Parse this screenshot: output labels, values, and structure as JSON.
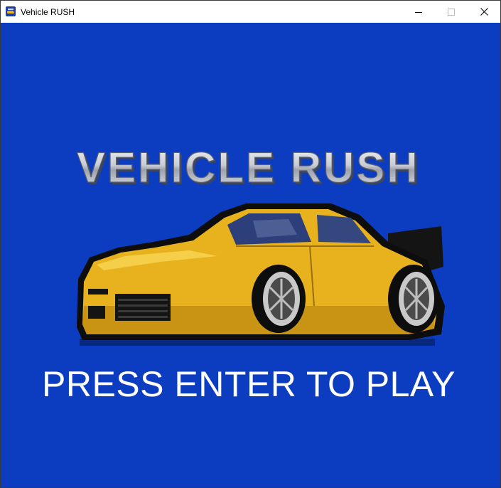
{
  "window": {
    "title": "Vehicle RUSH",
    "icon": "vehicle-rush-app-icon",
    "controls": [
      "minimize-icon",
      "maximize-icon",
      "close-icon"
    ]
  },
  "game": {
    "logo_text": "VEHICLE RUSH",
    "prompt": "PRESS ENTER TO PLAY",
    "colors": {
      "background": "#0c3dc0",
      "car_body": "#e8b21e",
      "car_shadow": "#b9860f",
      "prompt_text": "#ffffff",
      "logo_fill": "#d9dce4"
    }
  }
}
